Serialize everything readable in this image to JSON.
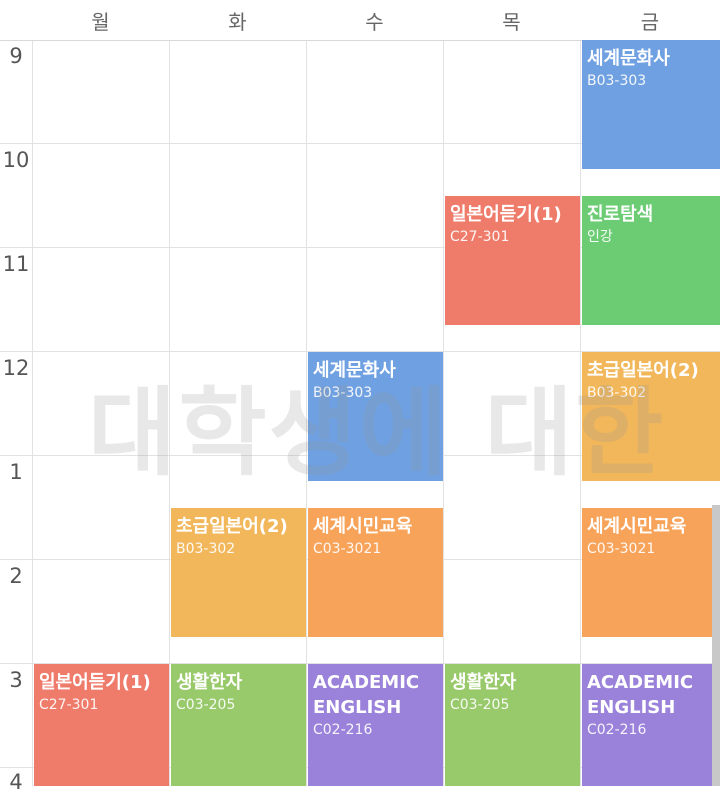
{
  "days": [
    "월",
    "화",
    "수",
    "목",
    "금"
  ],
  "hours": [
    "9",
    "10",
    "11",
    "12",
    "1",
    "2",
    "3",
    "4"
  ],
  "watermark": "대학생에 대한",
  "blocks": [
    {
      "title": "세계문화사",
      "room": "B03-303",
      "color": "#6fa0e1"
    },
    {
      "title": "일본어듣기(1)",
      "room": "C27-301",
      "color": "#ef7b6b"
    },
    {
      "title": "진로탐색",
      "room": "인강",
      "color": "#6ccc73"
    },
    {
      "title": "세계문화사",
      "room": "B03-303",
      "color": "#6fa0e1"
    },
    {
      "title": "초급일본어(2)",
      "room": "B03-302",
      "color": "#f2b75a"
    },
    {
      "title": "초급일본어(2)",
      "room": "B03-302",
      "color": "#f2b75a"
    },
    {
      "title": "세계시민교육",
      "room": "C03-3021",
      "color": "#f7a35a"
    },
    {
      "title": "세계시민교육",
      "room": "C03-3021",
      "color": "#f7a35a"
    },
    {
      "title": "일본어듣기(1)",
      "room": "C27-301",
      "color": "#ef7b6b"
    },
    {
      "title": "생활한자",
      "room": "C03-205",
      "color": "#98c96a"
    },
    {
      "title": "ACADEMIC\nENGLISH",
      "room": "C02-216",
      "color": "#9a82db"
    },
    {
      "title": "생활한자",
      "room": "C03-205",
      "color": "#98c96a"
    },
    {
      "title": "ACADEMIC\nENGLISH",
      "room": "C02-216",
      "color": "#9a82db"
    }
  ]
}
